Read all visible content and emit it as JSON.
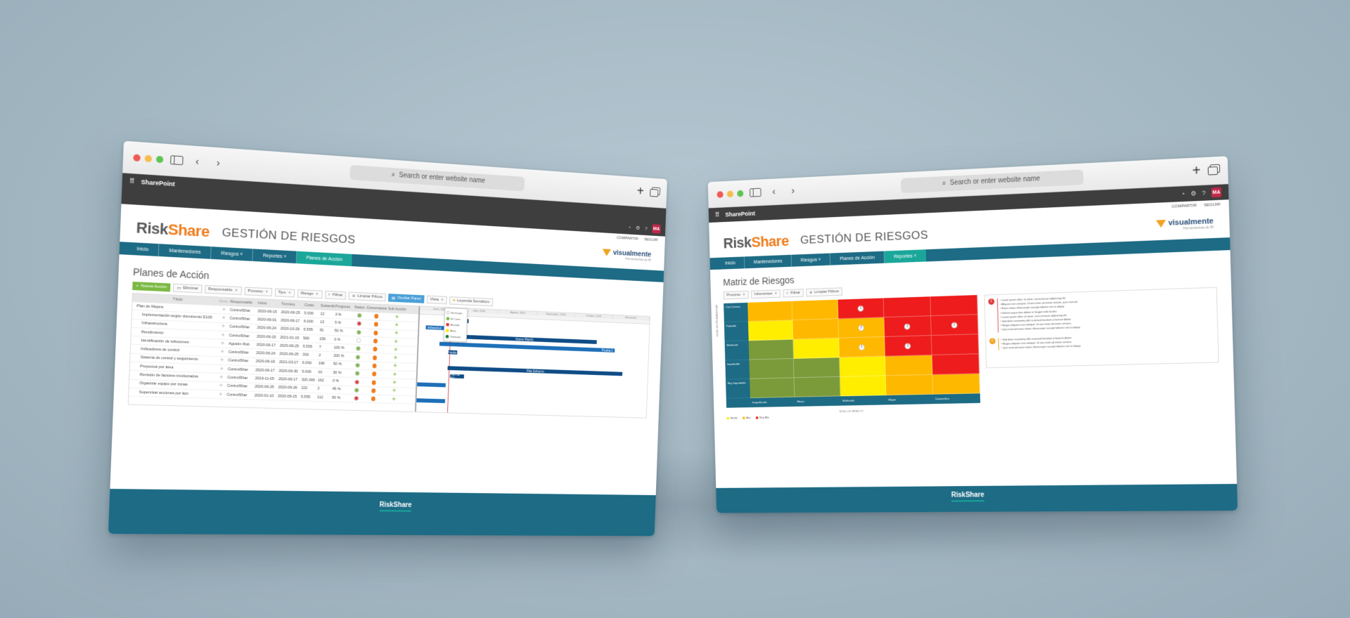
{
  "browser": {
    "url_placeholder": "Search or enter website name",
    "app_name": "SharePoint",
    "user_initials": "MA"
  },
  "brand": {
    "logo_part1": "Risk",
    "logo_part2": "Share",
    "section_title": "GESTIÓN DE RIESGOS",
    "partner_name": "visualmente",
    "partner_sub": "Herramientas de BI",
    "footer_logo": "RiskShare"
  },
  "site_actions": {
    "share": "COMPARTIR",
    "follow": "SEGUIR"
  },
  "left": {
    "nav": [
      "Inicio",
      "Mantenedores",
      "Riesgos ˅",
      "Reportes ˅",
      "Planes de Acción"
    ],
    "page_title": "Planes de Acción",
    "toolbar": {
      "new": "Nueva Acción",
      "delete": "Eliminar",
      "responsable": "Responsable",
      "proceso": "Proceso",
      "tipo": "Tipo",
      "riesgo": "Riesgo",
      "filter": "Filtrar",
      "clear": "Limpiar Filtros",
      "gantt": "Ocultar Panel",
      "view": "Vista",
      "legend": "Leyenda Semáforo"
    },
    "columns": [
      "Título",
      "Desc.",
      "Responsable",
      "Inicio",
      "Término",
      "Costo",
      "Sostenib",
      "Progreso",
      "Status",
      "Comentarios",
      "Sub Acción"
    ],
    "rows": [
      {
        "title": "Plan de Mejora",
        "resp": "ControlShar",
        "ini": "2020-06-15",
        "ter": "2020-06-25",
        "cos": "5.000",
        "sos": "12",
        "pro": "3 %",
        "st": "#7bb943"
      },
      {
        "title": "Implementación según documento D100",
        "resp": "ControlShar",
        "ini": "2020-06-01",
        "ter": "2020-06-17",
        "cos": "6.000",
        "sos": "13",
        "pro": "5 %",
        "st": "#e03a3a"
      },
      {
        "title": "Infraestructura",
        "resp": "ControlShar",
        "ini": "2020-06-24",
        "ter": "2020-10-29",
        "cos": "6.555",
        "sos": "91",
        "pro": "50 %",
        "st": "#7bb943"
      },
      {
        "title": "Rendimiento",
        "resp": "ControlShar",
        "ini": "2020-06-15",
        "ter": "2021-01-15",
        "cos": "500",
        "sos": "159",
        "pro": "0 %",
        "st": "#ffffff"
      },
      {
        "title": "Identificación de soluciones",
        "resp": "Agustín Rub",
        "ini": "2020-06-17",
        "ter": "2020-06-25",
        "cos": "5.555",
        "sos": "7",
        "pro": "100 %",
        "st": "#7bb943"
      },
      {
        "title": "Indicadores de control",
        "resp": "ControlShar",
        "ini": "2020-06-24",
        "ter": "2020-06-25",
        "cos": "333",
        "sos": "2",
        "pro": "200 %",
        "st": "#7bb943"
      },
      {
        "title": "Sistema de control y seguimiento",
        "resp": "ControlShar",
        "ini": "2020-06-16",
        "ter": "2021-03-17",
        "cos": "6.000",
        "sos": "196",
        "pro": "50 %",
        "st": "#7bb943"
      },
      {
        "title": "Proyectos por área",
        "resp": "ControlShar",
        "ini": "2020-06-17",
        "ter": "2020-06-30",
        "cos": "5.000",
        "sos": "10",
        "pro": "30 %",
        "st": "#7bb943"
      },
      {
        "title": "Revisión de factores involucrados",
        "resp": "ControlShar",
        "ini": "2019-11-05",
        "ter": "2020-06-17",
        "cos": "320.000",
        "sos": "162",
        "pro": "0 %",
        "st": "#e03a3a"
      },
      {
        "title": "Organizar equipo por zonas",
        "resp": "ControlShar",
        "ini": "2020-06-25",
        "ter": "2020-06-26",
        "cos": "222",
        "sos": "2",
        "pro": "45 %",
        "st": "#7bb943"
      },
      {
        "title": "Supervisar acciones por tipo",
        "resp": "ControlShar",
        "ini": "2020-01-10",
        "ter": "2020-06-15",
        "cos": "5.555",
        "sos": "112",
        "pro": "50 %",
        "st": "#e03a3a"
      }
    ],
    "gantt": {
      "months": [
        "Junio, 2020",
        "Julio, 2020",
        "Agosto, 2020",
        "Septiembre, 2020",
        "Octubre, 2020",
        "Noviembre"
      ],
      "bars": [
        "Plan de Mejora",
        "Infraestruc",
        "Nuevo Plan01",
        "Prueba 1",
        "Prueba",
        "Plan Esfuerzo",
        "Plan de Acc"
      ]
    },
    "status_legend": [
      "No Iniciado",
      "En Curso",
      "Atrasado",
      "Alerta",
      "Terminado"
    ]
  },
  "right": {
    "nav": [
      "Inicio",
      "Mantenedores",
      "Riesgos ˅",
      "Planes de Acción",
      "Reportes ˅"
    ],
    "page_title": "Matriz de Riesgos",
    "toolbar": {
      "proceso": "Proceso",
      "tipo": "Inherentes",
      "filter": "Filtrar",
      "clear": "Limpiar Filtros"
    },
    "y_axis_label": "NIVEL DE PROBABILIDAD",
    "x_axis_label": "NIVEL DE IMPACTO",
    "rows": [
      "Casi Certeza",
      "Probable",
      "Moderado",
      "Improbable",
      "Muy Improbable"
    ],
    "cols": [
      "Insignificante",
      "Menor",
      "Moderado",
      "Mayor",
      "Catastrófico"
    ],
    "legend": [
      "Medio",
      "Alto",
      "Muy Alto"
    ],
    "detail_red": [
      "Lorem ipsum dolor sit amet, consectetuer adipiscing elit",
      "Aliquam erat volutpat. Ut wisi enim ad minim veniam, quis nostrud",
      "Exerci tation ullamcorper suscipit lobortis nisl ut aliquip",
      "Delenit augue duis dolore te feugait nulla facilisi",
      "Lorem ipsum dolor sit amet, cons ectetuer adipiscing elit",
      "Sed diam nonummy nibh euismod tincidunt ut laoreet dolore",
      "Magna aliquam erat volutpat. Ut wisi enim ad minim veniam,",
      "Quis nostrud exerci tation ullamcorper suscipit lobortis nisl ut aliquip"
    ],
    "detail_orange": [
      "Sed diam nonummy nibh euismod tincidunt ut laoreet dolore",
      "Magna aliquam erat volutpat. Ut wisi enim ad minim veniam,",
      "Quis nostrud exerci tation ullamcorper suscipit lobortis nisl ut aliquip"
    ]
  }
}
